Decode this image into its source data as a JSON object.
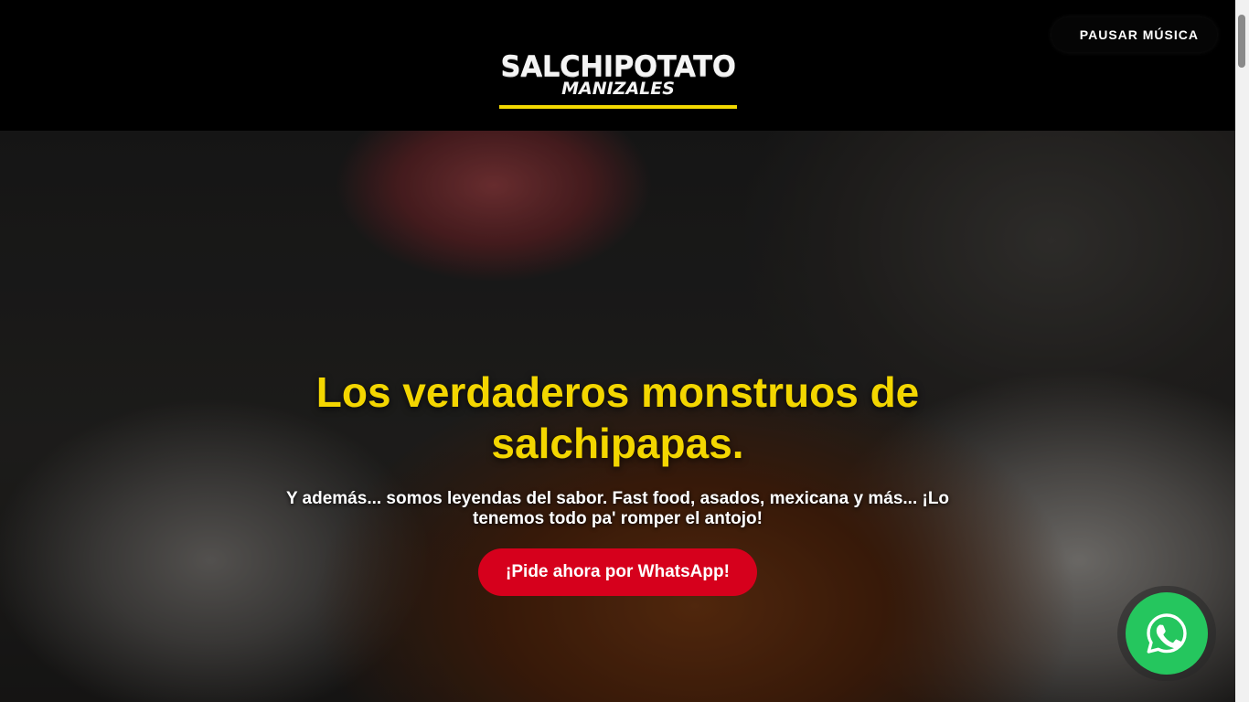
{
  "header": {
    "logo_main": "SALCHIPOTATO",
    "logo_sub": "MANIZALES",
    "music_button_label": "PAUSAR MÚSICA"
  },
  "hero": {
    "headline": "Los verdaderos monstruos de salchipapas.",
    "subtitle": "Y además... somos leyendas del sabor. Fast food, asados, mexicana y más... ¡Lo tenemos todo pa' romper el antojo!",
    "cta_label": "¡Pide ahora por WhatsApp!"
  },
  "floating": {
    "whatsapp_icon": "whatsapp-icon"
  },
  "colors": {
    "accent_yellow": "#f3d600",
    "cta_red": "#d6001c",
    "whatsapp_green": "#25c65e",
    "header_bg": "#000000"
  }
}
